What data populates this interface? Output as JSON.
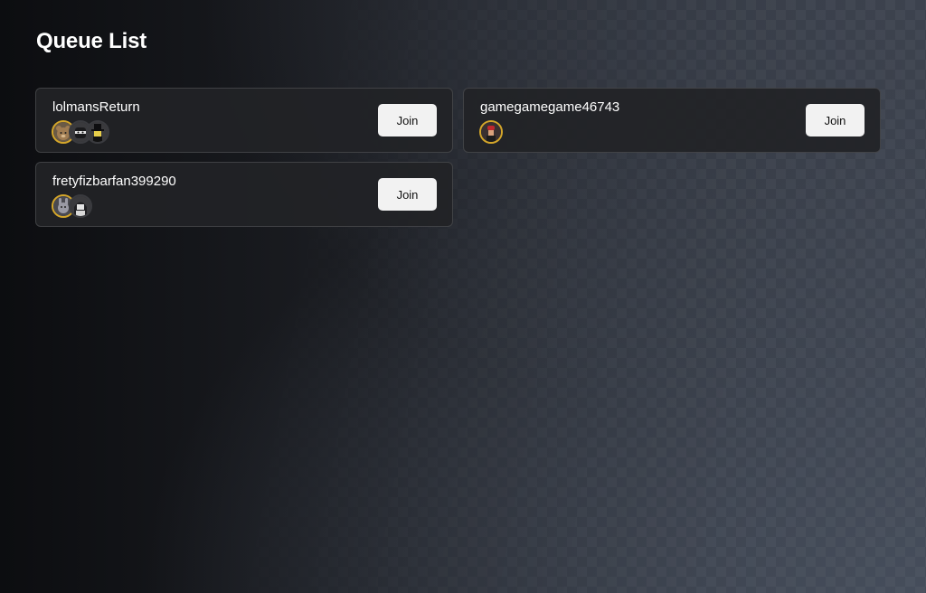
{
  "page": {
    "title": "Queue List"
  },
  "theme": {
    "card_background": "#222326",
    "button_background": "#f2f2f2",
    "avatar_gold_ring": "#d4a62a"
  },
  "queues": [
    {
      "name": "lolmansReturn",
      "join_label": "Join",
      "avatars": [
        {
          "icon": "bear-avatar-icon",
          "ring": "gold"
        },
        {
          "icon": "masked-avatar-icon",
          "ring": "gray"
        },
        {
          "icon": "top-hat-avatar-icon",
          "ring": "gray"
        }
      ]
    },
    {
      "name": "gamegamegame46743",
      "join_label": "Join",
      "avatars": [
        {
          "icon": "red-cap-avatar-icon",
          "ring": "gold"
        }
      ]
    },
    {
      "name": "fretyfizbarfan399290",
      "join_label": "Join",
      "avatars": [
        {
          "icon": "bunny-avatar-icon",
          "ring": "gold"
        },
        {
          "icon": "hooded-avatar-icon",
          "ring": "gray"
        }
      ]
    }
  ]
}
